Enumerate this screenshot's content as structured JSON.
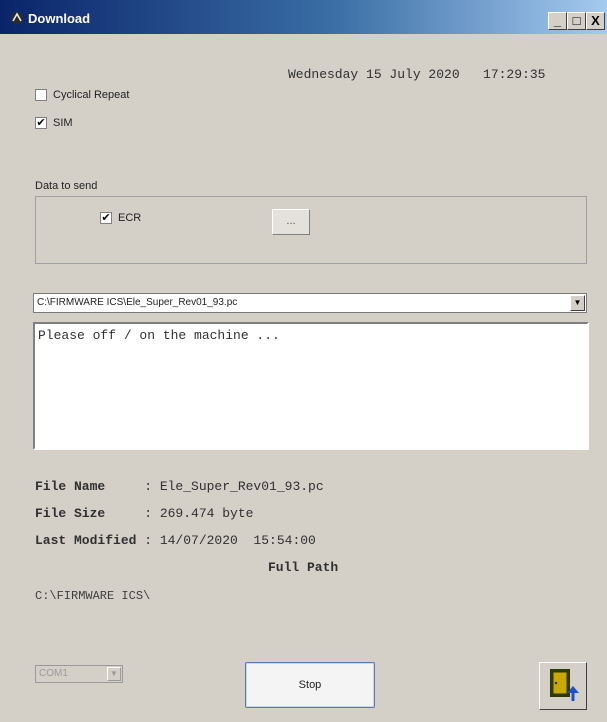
{
  "window": {
    "title": "Download",
    "controls": {
      "minimize": "_",
      "maximize": "□",
      "close": "X"
    }
  },
  "datetime": "Wednesday 15 July 2020   17:29:35",
  "options": {
    "cyclical_repeat": {
      "label": "Cyclical Repeat",
      "checked": false
    },
    "sim": {
      "label": "SIM",
      "checked": true
    }
  },
  "data_to_send": {
    "label": "Data to send",
    "ecr": {
      "label": "ECR",
      "checked": true
    },
    "browse_button": "..."
  },
  "file_combo": {
    "value": "C:\\FIRMWARE ICS\\Ele_Super_Rev01_93.pc"
  },
  "message": "Please off / on the machine ...",
  "file_info": {
    "name_label": "File Name     ",
    "name_value": ": Ele_Super_Rev01_93.pc",
    "size_label": "File Size     ",
    "size_value": ": 269.474 byte",
    "modified_label": "Last Modified ",
    "modified_value": ": 14/07/2020  15:54:00",
    "full_path_label": "Full Path",
    "full_path_value": "C:\\FIRMWARE ICS\\"
  },
  "port_select": {
    "value": "COM1"
  },
  "stop_button": "Stop",
  "icons": {
    "app": "download-app-icon",
    "exit": "exit-door-icon",
    "dropdown": "chevron-down-icon"
  },
  "colors": {
    "titlebar_start": "#0a246a",
    "titlebar_end": "#a6caf0",
    "window_bg": "#d4d0c8",
    "exit_door": "#2f3a05",
    "exit_arrow": "#1e4fd0"
  }
}
